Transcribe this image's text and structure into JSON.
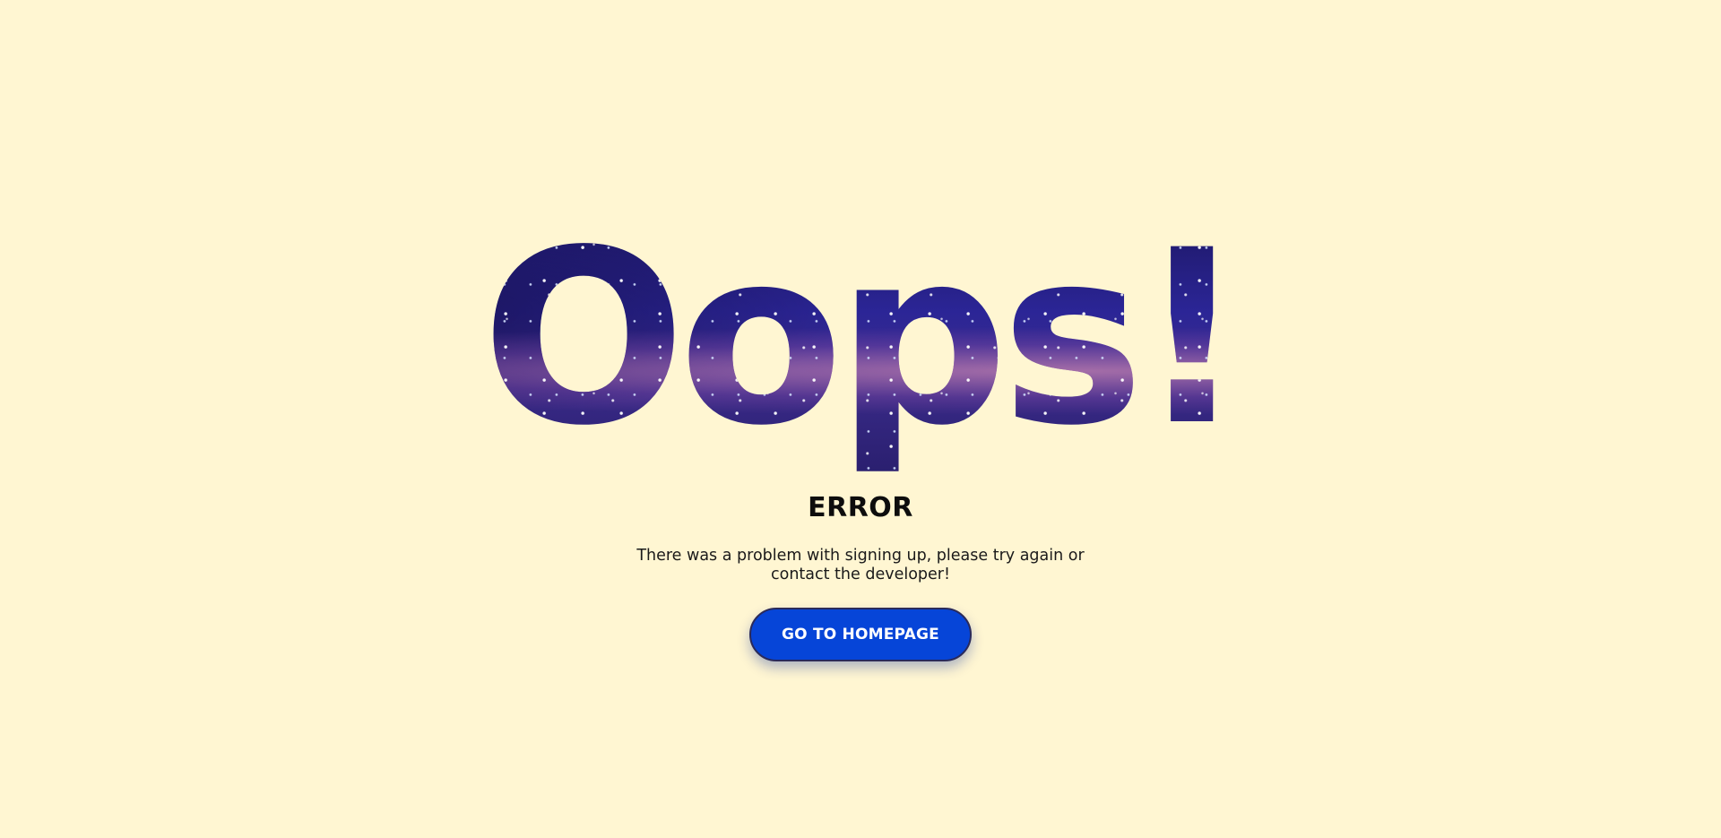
{
  "error_page": {
    "headline": "Oops!",
    "title": "ERROR",
    "message": "There was a problem with signing up, please try again or contact the developer!",
    "button_label": "GO TO HOMEPAGE"
  },
  "colors": {
    "background": "#fff6d2",
    "button": "#0645d8",
    "text": "#111111"
  }
}
